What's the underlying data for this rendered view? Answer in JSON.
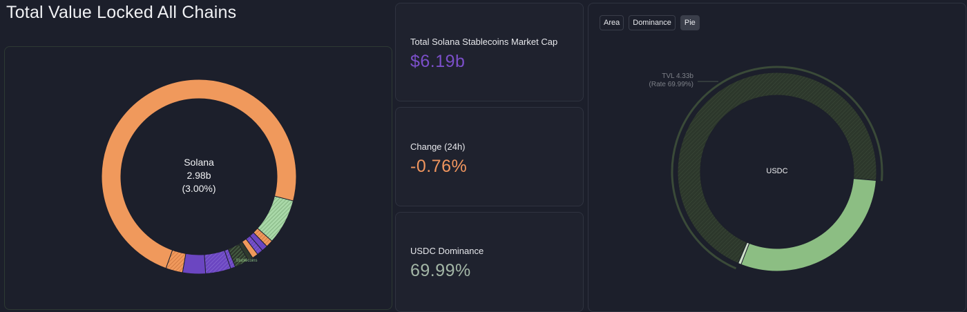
{
  "title": "Total Value Locked All Chains",
  "colors": {
    "background": "#1c1f2b",
    "orange": "#f0995c",
    "purple": "#6b46c1",
    "green": "#8cbe83",
    "darkgreen": "#2f3a2d",
    "value_purple": "#7b4fc9",
    "value_orange": "#f0955e",
    "value_green": "#a4b7a7"
  },
  "left_chart": {
    "center": {
      "name": "Solana",
      "value": "2.98b",
      "percent": "(3.00%)"
    },
    "small_label": "Stablecoins"
  },
  "stats": [
    {
      "label": "Total Solana Stablecoins Market Cap",
      "value": "$6.19b"
    },
    {
      "label": "Change (24h)",
      "value": "-0.76%"
    },
    {
      "label": "USDC Dominance",
      "value": "69.99%"
    }
  ],
  "right_panel": {
    "tabs": [
      "Area",
      "Dominance",
      "Pie"
    ],
    "active_tab": "Pie",
    "center_label": "USDC",
    "callout_line1": "TVL 4.33b",
    "callout_line2": "(Rate 69.99%)"
  },
  "chart_data": [
    {
      "type": "pie",
      "title": "Total Value Locked All Chains",
      "center_label": "Solana",
      "center_value": "2.98b",
      "center_percent": "(3.00%)",
      "slices": [
        {
          "name": "",
          "share": 0.735,
          "color": "#f0995c"
        },
        {
          "name": "",
          "share": 0.075,
          "color": "#a9d8a8",
          "pattern": true
        },
        {
          "name": "",
          "share": 0.012,
          "color": "#f0995c",
          "pattern": true
        },
        {
          "name": "",
          "share": 0.01,
          "color": "#6b46c1"
        },
        {
          "name": "",
          "share": 0.01,
          "color": "#8c70d6",
          "pattern": true
        },
        {
          "name": "",
          "share": 0.01,
          "color": "#f0995c"
        },
        {
          "name": "",
          "share": 0.008,
          "color": "#2f3a2d"
        },
        {
          "name": "",
          "share": 0.024,
          "color": "#2f3a2d",
          "pattern": true
        },
        {
          "name": "Stablecoins",
          "share": 0.008,
          "color": "#6b46c1",
          "pattern": true
        },
        {
          "name": "",
          "share": 0.042,
          "color": "#6b46c1",
          "pattern": true
        },
        {
          "name": "",
          "share": 0.038,
          "color": "#6b46c1"
        },
        {
          "name": "",
          "share": 0.028,
          "color": "#f0995c",
          "pattern": true
        }
      ]
    },
    {
      "type": "pie",
      "center_label": "USDC",
      "callout": "TVL 4.33b (Rate 69.99%)",
      "slices": [
        {
          "name": "USDC",
          "share": 0.6999,
          "color": "#2f3a2d",
          "pattern": true
        },
        {
          "name": "",
          "share": 0.2951,
          "color": "#8cbe83"
        },
        {
          "name": "",
          "share": 0.005,
          "color": "#cfe0ca"
        }
      ]
    }
  ]
}
